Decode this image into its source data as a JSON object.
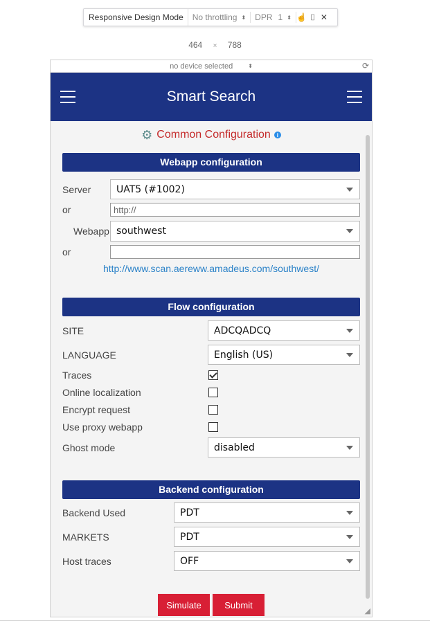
{
  "rdm_toolbar": {
    "title": "Responsive Design Mode",
    "throttling": "No throttling",
    "dpr_label": "DPR",
    "dpr_value": "1"
  },
  "viewport": {
    "width": "464",
    "height": "788",
    "separator": "×"
  },
  "device_bar": {
    "device": "no device selected"
  },
  "app": {
    "title": "Smart Search",
    "common_config": "Common Configuration"
  },
  "webapp": {
    "header": "Webapp configuration",
    "server_label": "Server",
    "server_value": "UAT5 (#1002)",
    "or1": "or",
    "url_placeholder": "http://",
    "webapp_label": "Webapp",
    "webapp_value": "southwest",
    "or2": "or",
    "link": "http://www.scan.aereww.amadeus.com/southwest/"
  },
  "flow": {
    "header": "Flow configuration",
    "site_label": "SITE",
    "site_value": "ADCQADCQ",
    "language_label": "LANGUAGE",
    "language_value": "English (US)",
    "traces_label": "Traces",
    "traces_checked": true,
    "online_label": "Online localization",
    "online_checked": false,
    "encrypt_label": "Encrypt request",
    "encrypt_checked": false,
    "proxy_label": "Use proxy webapp",
    "proxy_checked": false,
    "ghost_label": "Ghost mode",
    "ghost_value": "disabled"
  },
  "backend": {
    "header": "Backend configuration",
    "used_label": "Backend Used",
    "used_value": "PDT",
    "markets_label": "MARKETS",
    "markets_value": "PDT",
    "host_label": "Host traces",
    "host_value": "OFF"
  },
  "actions": {
    "simulate": "Simulate",
    "submit": "Submit"
  },
  "colors": {
    "primary": "#1c3384",
    "accent": "#d81f35",
    "title_red": "#c42a2a",
    "link": "#2b82c8"
  }
}
